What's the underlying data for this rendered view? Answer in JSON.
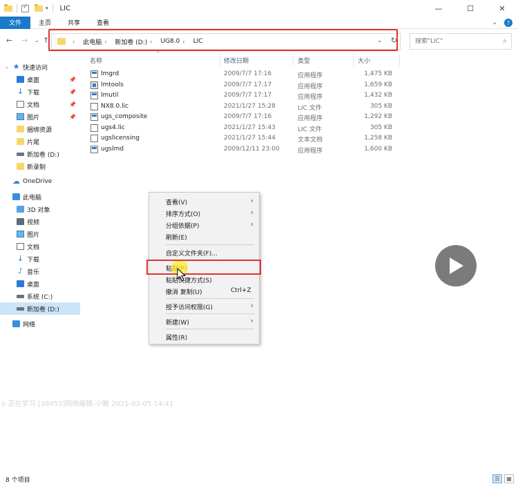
{
  "window": {
    "title": "LIC"
  },
  "ribbon": {
    "tabs": [
      "文件",
      "主页",
      "共享",
      "查看"
    ],
    "active_tab": "文件"
  },
  "address": {
    "breadcrumb": [
      "此电脑",
      "新加卷 (D:)",
      "UG8.0",
      "LIC"
    ]
  },
  "search": {
    "placeholder": "搜索\"LIC\""
  },
  "nav": {
    "quick_access": "快速访问",
    "quick_items": [
      {
        "label": "桌面",
        "icon": "desktop-icon",
        "pinned": true
      },
      {
        "label": "下载",
        "icon": "download-icon",
        "pinned": true
      },
      {
        "label": "文档",
        "icon": "document-icon",
        "pinned": true
      },
      {
        "label": "图片",
        "icon": "picture-icon",
        "pinned": true
      },
      {
        "label": "捆绑资源",
        "icon": "folder-icon",
        "pinned": false
      },
      {
        "label": "片尾",
        "icon": "folder-icon",
        "pinned": false
      },
      {
        "label": "新加卷 (D:)",
        "icon": "drive-icon",
        "pinned": false
      },
      {
        "label": "新录制",
        "icon": "folder-icon",
        "pinned": false
      }
    ],
    "onedrive": "OneDrive",
    "this_pc": "此电脑",
    "pc_items": [
      {
        "label": "3D 对象",
        "icon": "3d-objects-icon"
      },
      {
        "label": "视频",
        "icon": "video-icon"
      },
      {
        "label": "图片",
        "icon": "picture-icon"
      },
      {
        "label": "文档",
        "icon": "document-icon"
      },
      {
        "label": "下载",
        "icon": "download-icon"
      },
      {
        "label": "音乐",
        "icon": "music-icon"
      },
      {
        "label": "桌面",
        "icon": "desktop-icon"
      },
      {
        "label": "系统 (C:)",
        "icon": "drive-icon"
      },
      {
        "label": "新加卷 (D:)",
        "icon": "drive-icon"
      }
    ],
    "network": "网络"
  },
  "columns": {
    "name": "名称",
    "date": "修改日期",
    "type": "类型",
    "size": "大小"
  },
  "files": [
    {
      "name": "lmgrd",
      "date": "2009/7/7 17:16",
      "type": "应用程序",
      "size": "1,475 KB",
      "icon": "exe"
    },
    {
      "name": "lmtools",
      "date": "2009/7/7 17:17",
      "type": "应用程序",
      "size": "1,659 KB",
      "icon": "tool"
    },
    {
      "name": "lmutil",
      "date": "2009/7/7 17:17",
      "type": "应用程序",
      "size": "1,432 KB",
      "icon": "exe"
    },
    {
      "name": "NX8.0.lic",
      "date": "2021/1/27 15:28",
      "type": "LIC 文件",
      "size": "305 KB",
      "icon": "doc"
    },
    {
      "name": "ugs_composite",
      "date": "2009/7/7 17:16",
      "type": "应用程序",
      "size": "1,292 KB",
      "icon": "exe"
    },
    {
      "name": "ugs4.lic",
      "date": "2021/1/27 15:43",
      "type": "LIC 文件",
      "size": "305 KB",
      "icon": "doc"
    },
    {
      "name": "ugslicensing",
      "date": "2021/1/27 15:44",
      "type": "文本文档",
      "size": "1,258 KB",
      "icon": "doc"
    },
    {
      "name": "ugslmd",
      "date": "2009/12/11 23:00",
      "type": "应用程序",
      "size": "1,600 KB",
      "icon": "exe"
    }
  ],
  "context_menu": {
    "view": "查看(V)",
    "sort": "排序方式(O)",
    "group": "分组依据(P)",
    "refresh": "刷新(E)",
    "customize": "自定义文件夹(F)...",
    "paste": "粘贴(P)",
    "paste_shortcut": "粘贴快捷方式(S)",
    "undo": "撤消 复制(U)",
    "undo_shortcut": "Ctrl+Z",
    "access": "授予访问权限(G)",
    "new": "新建(W)",
    "properties": "属性(R)"
  },
  "watermark": "n 正在学习 [38453]网络编辑-小雅 2021-03-05 14:41",
  "status": {
    "item_count": "8 个项目"
  }
}
